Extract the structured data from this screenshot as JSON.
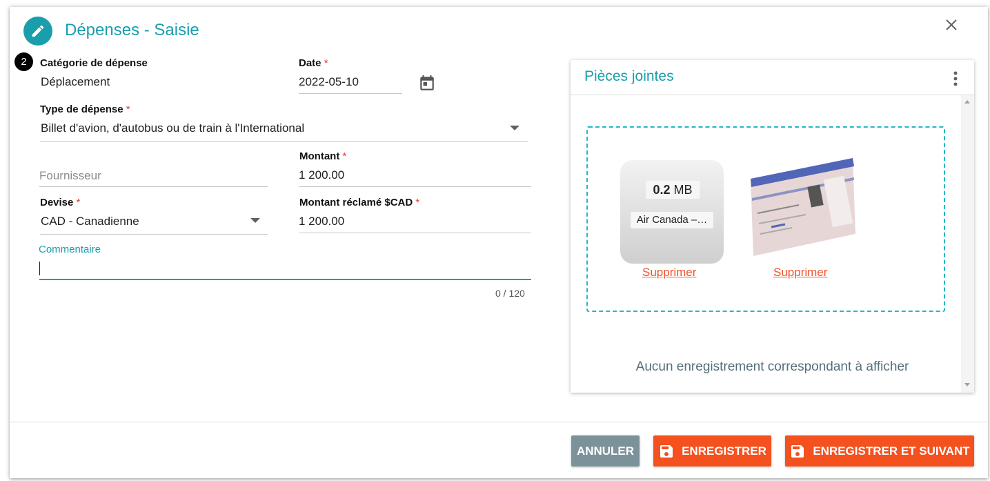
{
  "dialog": {
    "title": "Dépenses - Saisie",
    "step_number": "2"
  },
  "form": {
    "category": {
      "label": "Catégorie de dépense",
      "value": "Déplacement"
    },
    "date": {
      "label": "Date",
      "required_mark": "*",
      "value": "2022-05-10"
    },
    "expense_type": {
      "label": "Type de dépense",
      "required_mark": "*",
      "value": "Billet d'avion, d'autobus ou de train à l'International"
    },
    "supplier": {
      "placeholder": "Fournisseur"
    },
    "amount": {
      "label": "Montant",
      "required_mark": "*",
      "value": "1 200.00"
    },
    "currency": {
      "label": "Devise",
      "required_mark": "*",
      "value": "CAD - Canadienne"
    },
    "claimed_amount": {
      "label": "Montant réclamé $CAD",
      "required_mark": "*",
      "value": "1 200.00"
    },
    "comment": {
      "label": "Commentaire",
      "value": "",
      "counter": "0 / 120"
    }
  },
  "attachments": {
    "title": "Pièces jointes",
    "files": [
      {
        "size_number": "0.2",
        "size_unit": "MB",
        "name": "Air Canada –…",
        "delete_label": "Supprimer"
      },
      {
        "kind": "boarding-pass-image",
        "delete_label": "Supprimer"
      }
    ],
    "empty_message": "Aucun enregistrement correspondant à afficher"
  },
  "footer": {
    "cancel_label": "ANNULER",
    "save_label": "ENREGISTRER",
    "save_next_label": "ENREGISTRER ET SUIVANT"
  },
  "colors": {
    "accent": "#1a9eac",
    "primary_button": "#f4511e",
    "cancel_button": "#7c929b",
    "required": "#e53935",
    "dropzone_border": "#26b6c6"
  }
}
